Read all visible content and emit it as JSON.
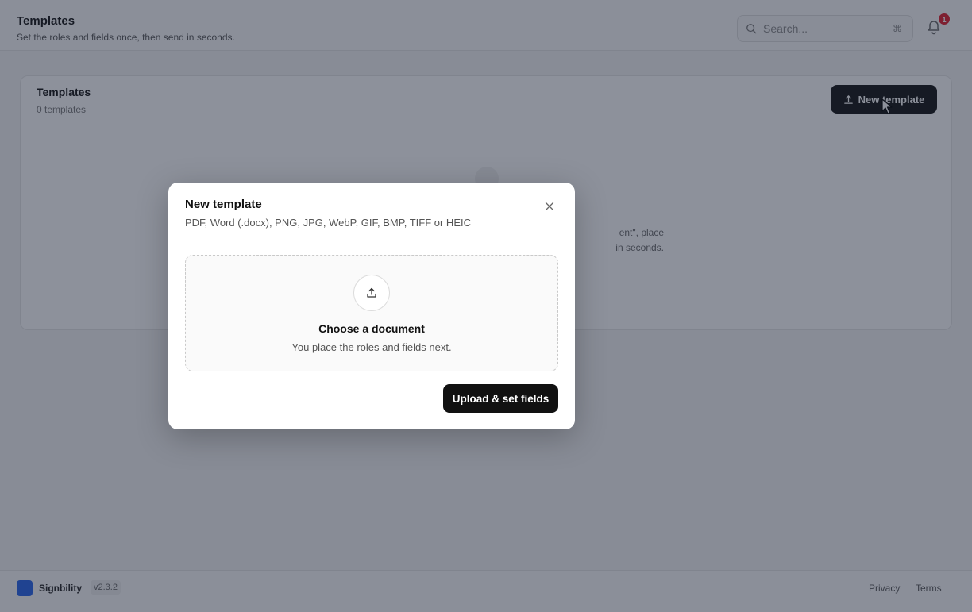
{
  "header": {
    "title": "Templates",
    "subtitle": "Set the roles and fields once, then send in seconds.",
    "search_placeholder": "Search...",
    "search_shortcut": "⌘",
    "notification_count": "1"
  },
  "card": {
    "title": "Templates",
    "count": "0 templates",
    "new_button_label": "New template",
    "empty_line1": "ent\", place",
    "empty_line2": "in seconds."
  },
  "footer": {
    "brand": "Signbility",
    "version": "v2.3.2",
    "privacy": "Privacy",
    "terms": "Terms"
  },
  "dialog": {
    "title": "New template",
    "subtitle": "PDF, Word (.docx), PNG, JPG, WebP, GIF, BMP, TIFF or HEIC",
    "dropzone_title": "Choose a document",
    "dropzone_subtitle": "You place the roles and fields next.",
    "primary_label": "Upload & set fields"
  },
  "colors": {
    "primary": "#111111",
    "badge": "#e11d2a",
    "brand": "#2563eb",
    "overlay": "rgba(28,36,56,0.5)"
  }
}
